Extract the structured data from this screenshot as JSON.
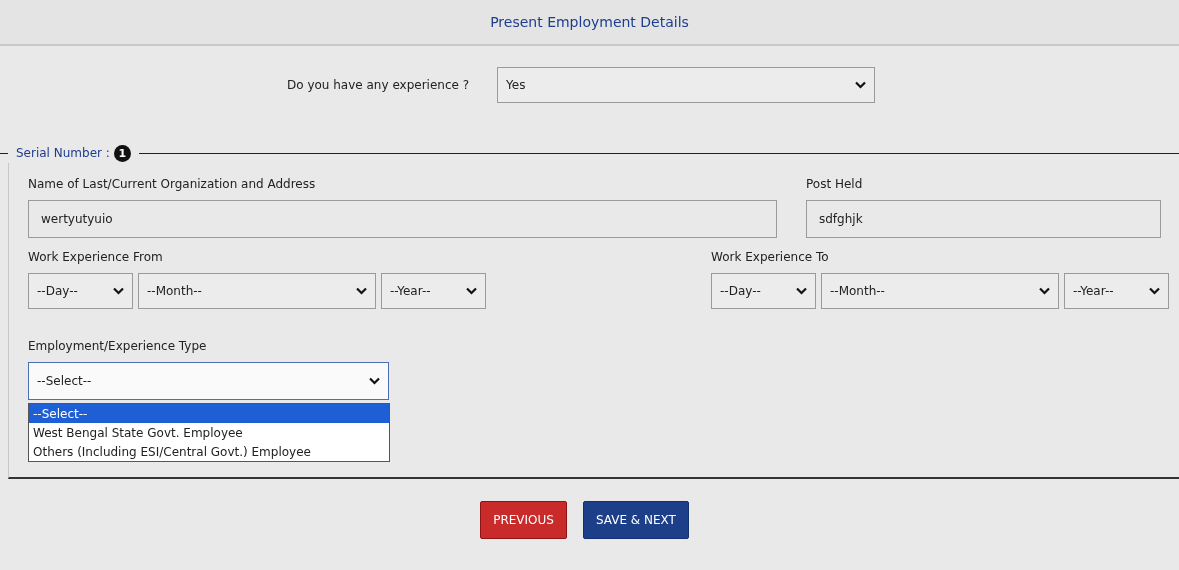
{
  "header": {
    "title": "Present Employment Details"
  },
  "experience": {
    "label": "Do you have any experience ?",
    "value": "Yes"
  },
  "serial": {
    "label": "Serial Number :",
    "number": "1"
  },
  "organization": {
    "label": "Name of Last/Current Organization and Address",
    "value": "wertyutyuio"
  },
  "post": {
    "label": "Post Held",
    "value": "sdfghjk"
  },
  "from": {
    "label": "Work Experience From",
    "day": "--Day--",
    "month": "--Month--",
    "year": "--Year--"
  },
  "to": {
    "label": "Work Experience To",
    "day": "--Day--",
    "month": "--Month--",
    "year": "--Year--"
  },
  "employment_type": {
    "label": "Employment/Experience Type",
    "value": "--Select--",
    "expanded": true,
    "options": [
      {
        "label": "--Select--",
        "selected": true
      },
      {
        "label": "West Bengal State Govt. Employee",
        "selected": false
      },
      {
        "label": "Others (Including ESI/Central Govt.) Employee",
        "selected": false
      }
    ]
  },
  "buttons": [
    {
      "label": "PREVIOUS",
      "kind": "secondary"
    },
    {
      "label": "SAVE & NEXT",
      "kind": "primary"
    }
  ]
}
